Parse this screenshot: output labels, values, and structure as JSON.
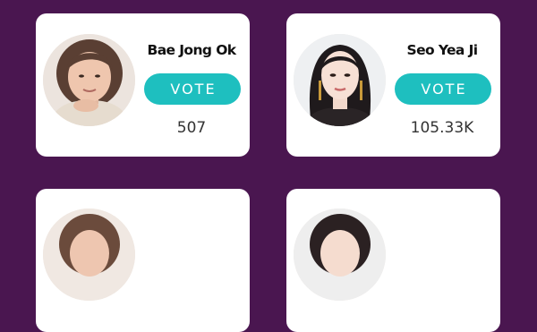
{
  "colors": {
    "background": "#4a1650",
    "card": "#ffffff",
    "vote_button": "#1ebfbf"
  },
  "candidates": [
    {
      "name": "Bae Jong Ok",
      "vote_label": "VOTE",
      "votes": "507",
      "photo": "candidate-photo-bae-jong-ok"
    },
    {
      "name": "Seo Yea Ji",
      "vote_label": "VOTE",
      "votes": "105.33K",
      "photo": "candidate-photo-seo-yea-ji"
    }
  ]
}
